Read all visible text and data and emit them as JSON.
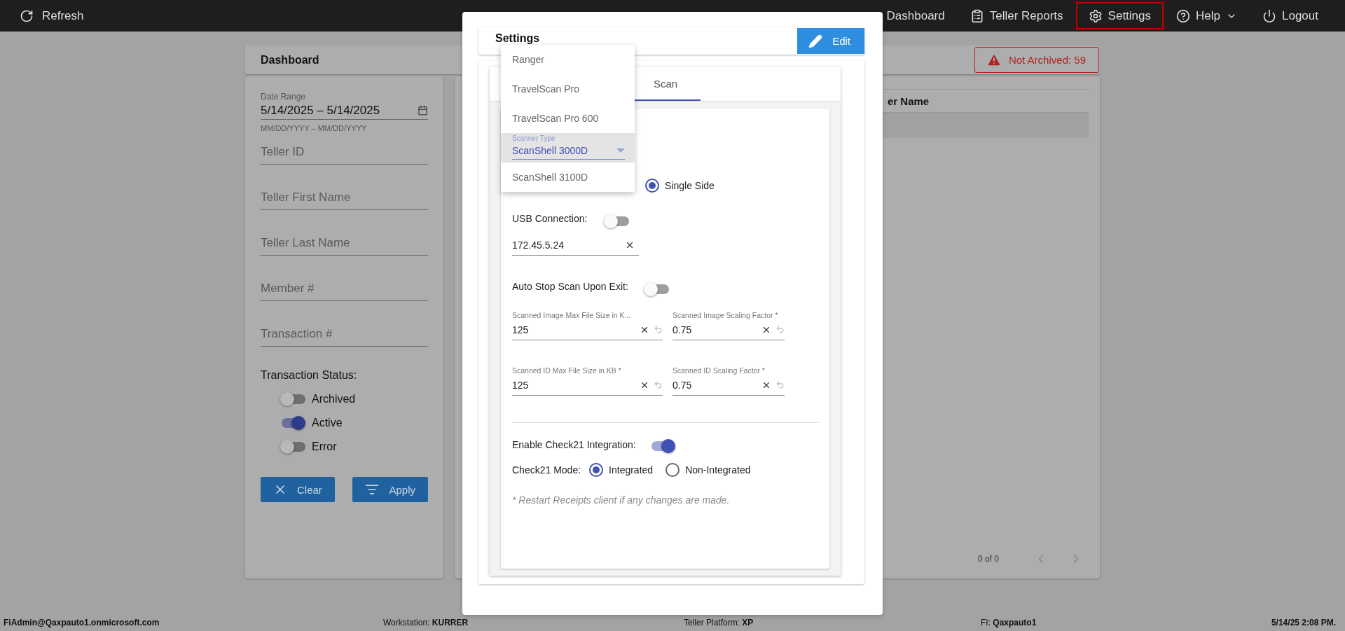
{
  "top_bar": {
    "refresh": "Refresh",
    "nav": [
      {
        "label": "Dashboard",
        "selected": false,
        "has_menu": false
      },
      {
        "label": "Teller Reports",
        "selected": false,
        "has_menu": false
      },
      {
        "label": "Settings",
        "selected": true,
        "has_menu": false
      },
      {
        "label": "Help",
        "selected": false,
        "has_menu": true
      },
      {
        "label": "Logout",
        "selected": false,
        "has_menu": false
      }
    ]
  },
  "dashboard": {
    "title": "Dashboard",
    "alert": "Not Archived: 59"
  },
  "filters": {
    "date_range": {
      "label": "Date Range",
      "value": "5/14/2025 – 5/14/2025",
      "helper": "MM/DD/YYYY – MM/DD/YYYY"
    },
    "fields": [
      {
        "placeholder": "Teller ID"
      },
      {
        "placeholder": "Teller First Name"
      },
      {
        "placeholder": "Teller Last Name"
      },
      {
        "placeholder": "Member #"
      },
      {
        "placeholder": "Transaction #"
      }
    ],
    "status_label": "Transaction Status:",
    "statuses": [
      {
        "label": "Archived",
        "on": false
      },
      {
        "label": "Active",
        "on": true
      },
      {
        "label": "Error",
        "on": false
      }
    ],
    "buttons": [
      {
        "label": "Clear"
      },
      {
        "label": "Apply"
      }
    ]
  },
  "table": {
    "columns": [
      "er Name"
    ],
    "pagination": "0 of 0"
  },
  "settings_dialog": {
    "title": "Settings",
    "edit": "Edit",
    "tabs": [
      {
        "label": "Scan",
        "selected": true
      }
    ],
    "scanner": {
      "label": "Scanner Type",
      "options": [
        {
          "label": "Ranger",
          "selected": false
        },
        {
          "label": "TravelScan Pro",
          "selected": false
        },
        {
          "label": "TravelScan Pro 600",
          "selected": false
        },
        {
          "label": "ScanShell 3000D",
          "selected": true
        },
        {
          "label": "ScanShell 3100D",
          "selected": false
        }
      ]
    },
    "scan_mode": {
      "options": [
        {
          "label": "Single Side",
          "selected": true
        }
      ]
    },
    "usb": {
      "label": "USB Connection:",
      "on": false
    },
    "ip_field": {
      "value": "172.45.5.24"
    },
    "auto_stop": {
      "label": "Auto Stop Scan Upon Exit:",
      "on": false
    },
    "number_fields": [
      {
        "label": "Scanned Image Max File Size in K...",
        "value": "125"
      },
      {
        "label": "Scanned Image Scaling Factor *",
        "value": "0.75"
      },
      {
        "label": "Scanned ID Max File Size in KB *",
        "value": "125"
      },
      {
        "label": "Scanned ID Scaling Factor *",
        "value": "0.75"
      }
    ],
    "check21": {
      "label": "Enable Check21 Integration:",
      "on": true
    },
    "check21_mode": {
      "label": "Check21 Mode:",
      "options": [
        {
          "label": "Integrated",
          "selected": true
        },
        {
          "label": "Non-Integrated",
          "selected": false
        }
      ]
    },
    "note": "* Restart Receipts client if any changes are made."
  },
  "status_bar": [
    {
      "text": "FiAdmin@Qaxpauto1.onmicrosoft.com",
      "bold": true
    },
    {
      "text": "Workstation: **KURRER**",
      "bold": false
    },
    {
      "text": "Teller Platform: **XP**",
      "bold": false
    },
    {
      "text": "FI: **Qaxpauto1**",
      "bold": false
    },
    {
      "text": "5/14/25 2:08 PM.",
      "bold": true
    }
  ]
}
